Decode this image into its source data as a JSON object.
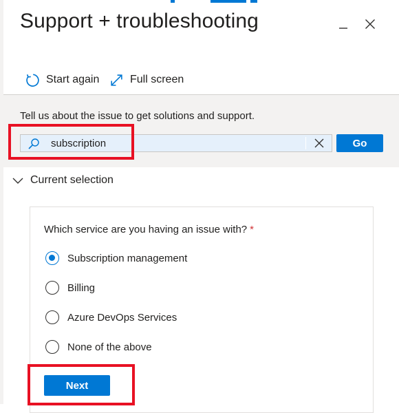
{
  "panel": {
    "title": "Support + troubleshooting",
    "minimize_icon": "minimize-icon",
    "close_icon": "close-icon"
  },
  "toolbar": {
    "start_again_label": "Start again",
    "start_again_icon": "refresh-icon",
    "full_screen_label": "Full screen",
    "full_screen_icon": "expand-icon"
  },
  "issue": {
    "prompt": "Tell us about the issue to get solutions and support.",
    "search_value": "subscription",
    "search_icon": "search-icon",
    "clear_icon": "clear-icon",
    "go_label": "Go"
  },
  "current_selection": {
    "label": "Current selection",
    "question": "Which service are you having an issue with?",
    "required_marker": "*",
    "options": [
      {
        "label": "Subscription management",
        "selected": true
      },
      {
        "label": "Billing",
        "selected": false
      },
      {
        "label": "Azure DevOps Services",
        "selected": false
      },
      {
        "label": "None of the above",
        "selected": false
      }
    ],
    "next_label": "Next"
  },
  "colors": {
    "accent": "#0078d4",
    "annotation": "#e81123",
    "required": "#d13438",
    "panel_background": "#f3f2f1",
    "search_background": "#e5f0fb"
  }
}
